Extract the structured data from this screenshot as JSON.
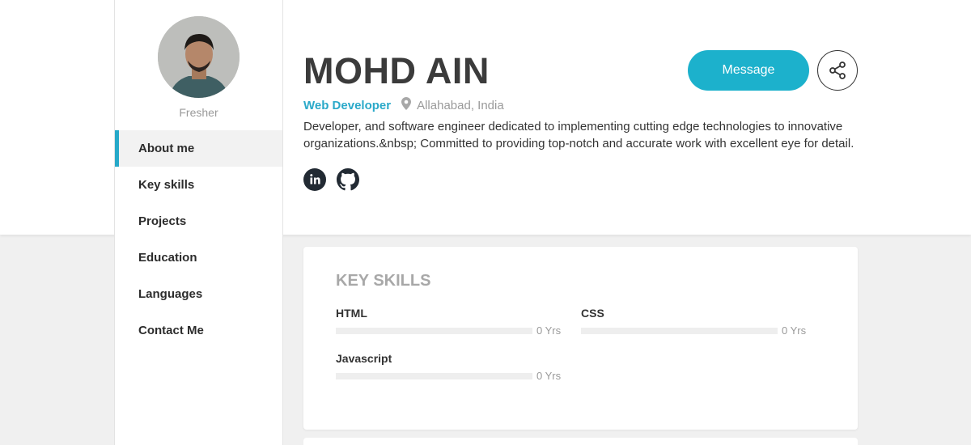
{
  "profile": {
    "avatar_caption": "Fresher",
    "name": "MOHD AIN",
    "role": "Web Developer",
    "location": "Allahabad, India",
    "bio": "Developer, and software engineer dedicated to implementing cutting edge technologies to innovative organizations.&nbsp; Committed to providing top-notch and accurate work with excellent eye for detail."
  },
  "actions": {
    "message_label": "Message"
  },
  "social": [
    {
      "icon": "linkedin-icon"
    },
    {
      "icon": "github-icon"
    }
  ],
  "sidebar": {
    "items": [
      {
        "label": "About me",
        "active": true
      },
      {
        "label": "Key skills"
      },
      {
        "label": "Projects"
      },
      {
        "label": "Education"
      },
      {
        "label": "Languages"
      },
      {
        "label": "Contact Me"
      }
    ]
  },
  "key_skills": {
    "title": "KEY SKILLS",
    "skills": [
      {
        "name": "HTML",
        "years": "0 Yrs",
        "level": 0
      },
      {
        "name": "CSS",
        "years": "0 Yrs",
        "level": 0
      },
      {
        "name": "Javascript",
        "years": "0 Yrs",
        "level": 0
      }
    ]
  },
  "colors": {
    "accent": "#1cb1cc",
    "nav_active_border": "#26a9c9"
  }
}
